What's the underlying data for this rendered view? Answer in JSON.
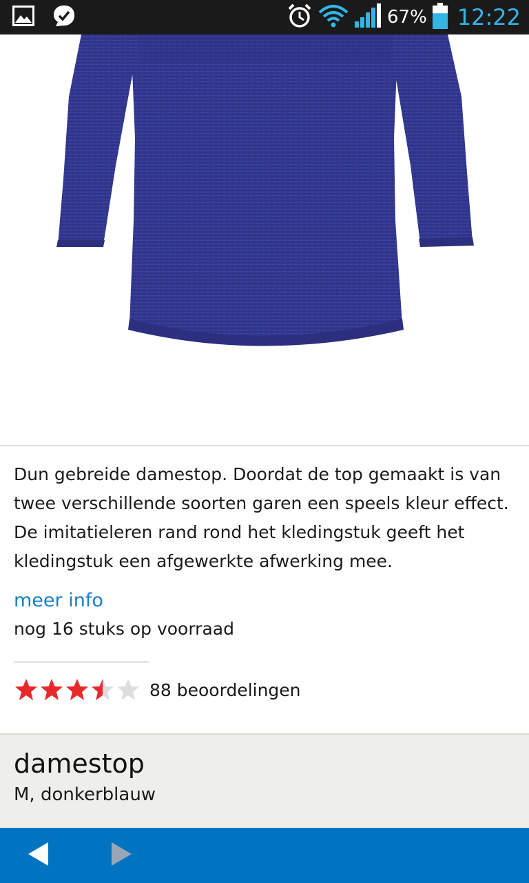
{
  "status_bar": {
    "battery_percent": "67%",
    "time": "12:22",
    "battery_level": 0.67,
    "icons": [
      "gallery-icon",
      "check-badge-icon",
      "alarm-clock-icon",
      "wifi-icon",
      "signal-icon",
      "battery-icon"
    ]
  },
  "product": {
    "image": "navy-knit-top-image",
    "description": "Dun gebreide damestop. Doordat de top gemaakt is van twee verschillende soorten garen een speels kleur effect. De imitatieleren rand rond het kledingstuk geeft het kledingstuk een afgewerkte afwerking mee.",
    "more_info_label": "meer info",
    "stock_text": "nog 16 stuks op voorraad",
    "rating": {
      "stars": 3.5,
      "max_stars": 5,
      "count_label": "88 beoordelingen"
    }
  },
  "summary": {
    "title": "damestop",
    "variant": "M, donkerblauw"
  },
  "nav": {
    "back": "arrow-left-icon",
    "forward": "arrow-right-icon"
  },
  "colors": {
    "accent": "#0074c1",
    "link": "#1a7ec4",
    "star_filled": "#e8292b",
    "star_empty": "#dddddd",
    "status_time": "#33b5e5"
  }
}
